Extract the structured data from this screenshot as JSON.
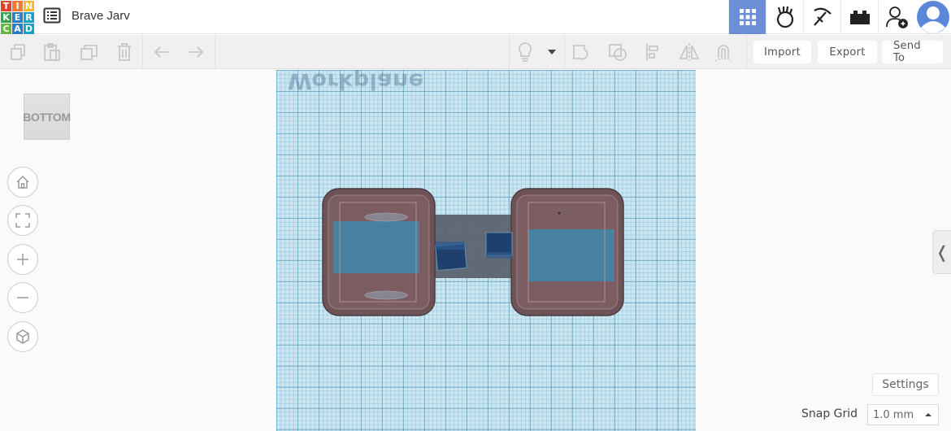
{
  "app": {
    "logo_letters": [
      "T",
      "I",
      "N",
      "K",
      "E",
      "R",
      "C",
      "A",
      "D"
    ],
    "logo_colors": [
      "#e2412b",
      "#f37935",
      "#f5b82e",
      "#33a352",
      "#2b7cc1",
      "#1aa1c9",
      "#65b73f",
      "#2b7cc1",
      "#1aa1c9"
    ],
    "project_title": "Brave Jarv"
  },
  "topnav": {
    "items": [
      "grid-view-icon",
      "circuits-hand-icon",
      "minecraft-pickaxe-icon",
      "bricks-icon",
      "invite-user-icon",
      "user-avatar"
    ],
    "active_color": "#6b8fd6"
  },
  "toolbar": {
    "edit_icons": [
      "copy-icon",
      "paste-icon",
      "duplicate-icon",
      "delete-icon",
      "undo-icon",
      "redo-icon"
    ],
    "shape_icons": [
      "light-bulb-icon",
      "dropdown-arrow-icon",
      "group-icon",
      "ungroup-icon",
      "align-icon",
      "mirror-icon",
      "cruise-magnet-icon"
    ],
    "import_label": "Import",
    "export_label": "Export",
    "send_to_label": "Send To"
  },
  "viewport": {
    "viewcube_label": "BOTTOM",
    "nav_buttons": [
      "home-view-icon",
      "fit-view-icon",
      "zoom-in-icon",
      "zoom-out-icon",
      "perspective-icon"
    ],
    "workplane_label": "Workplane",
    "workplane_color": "#cbe6f1"
  },
  "panel": {
    "collapse_glyph": "❬",
    "settings_label": "Settings",
    "snap_grid_label": "Snap Grid",
    "snap_grid_value": "1.0 mm"
  }
}
